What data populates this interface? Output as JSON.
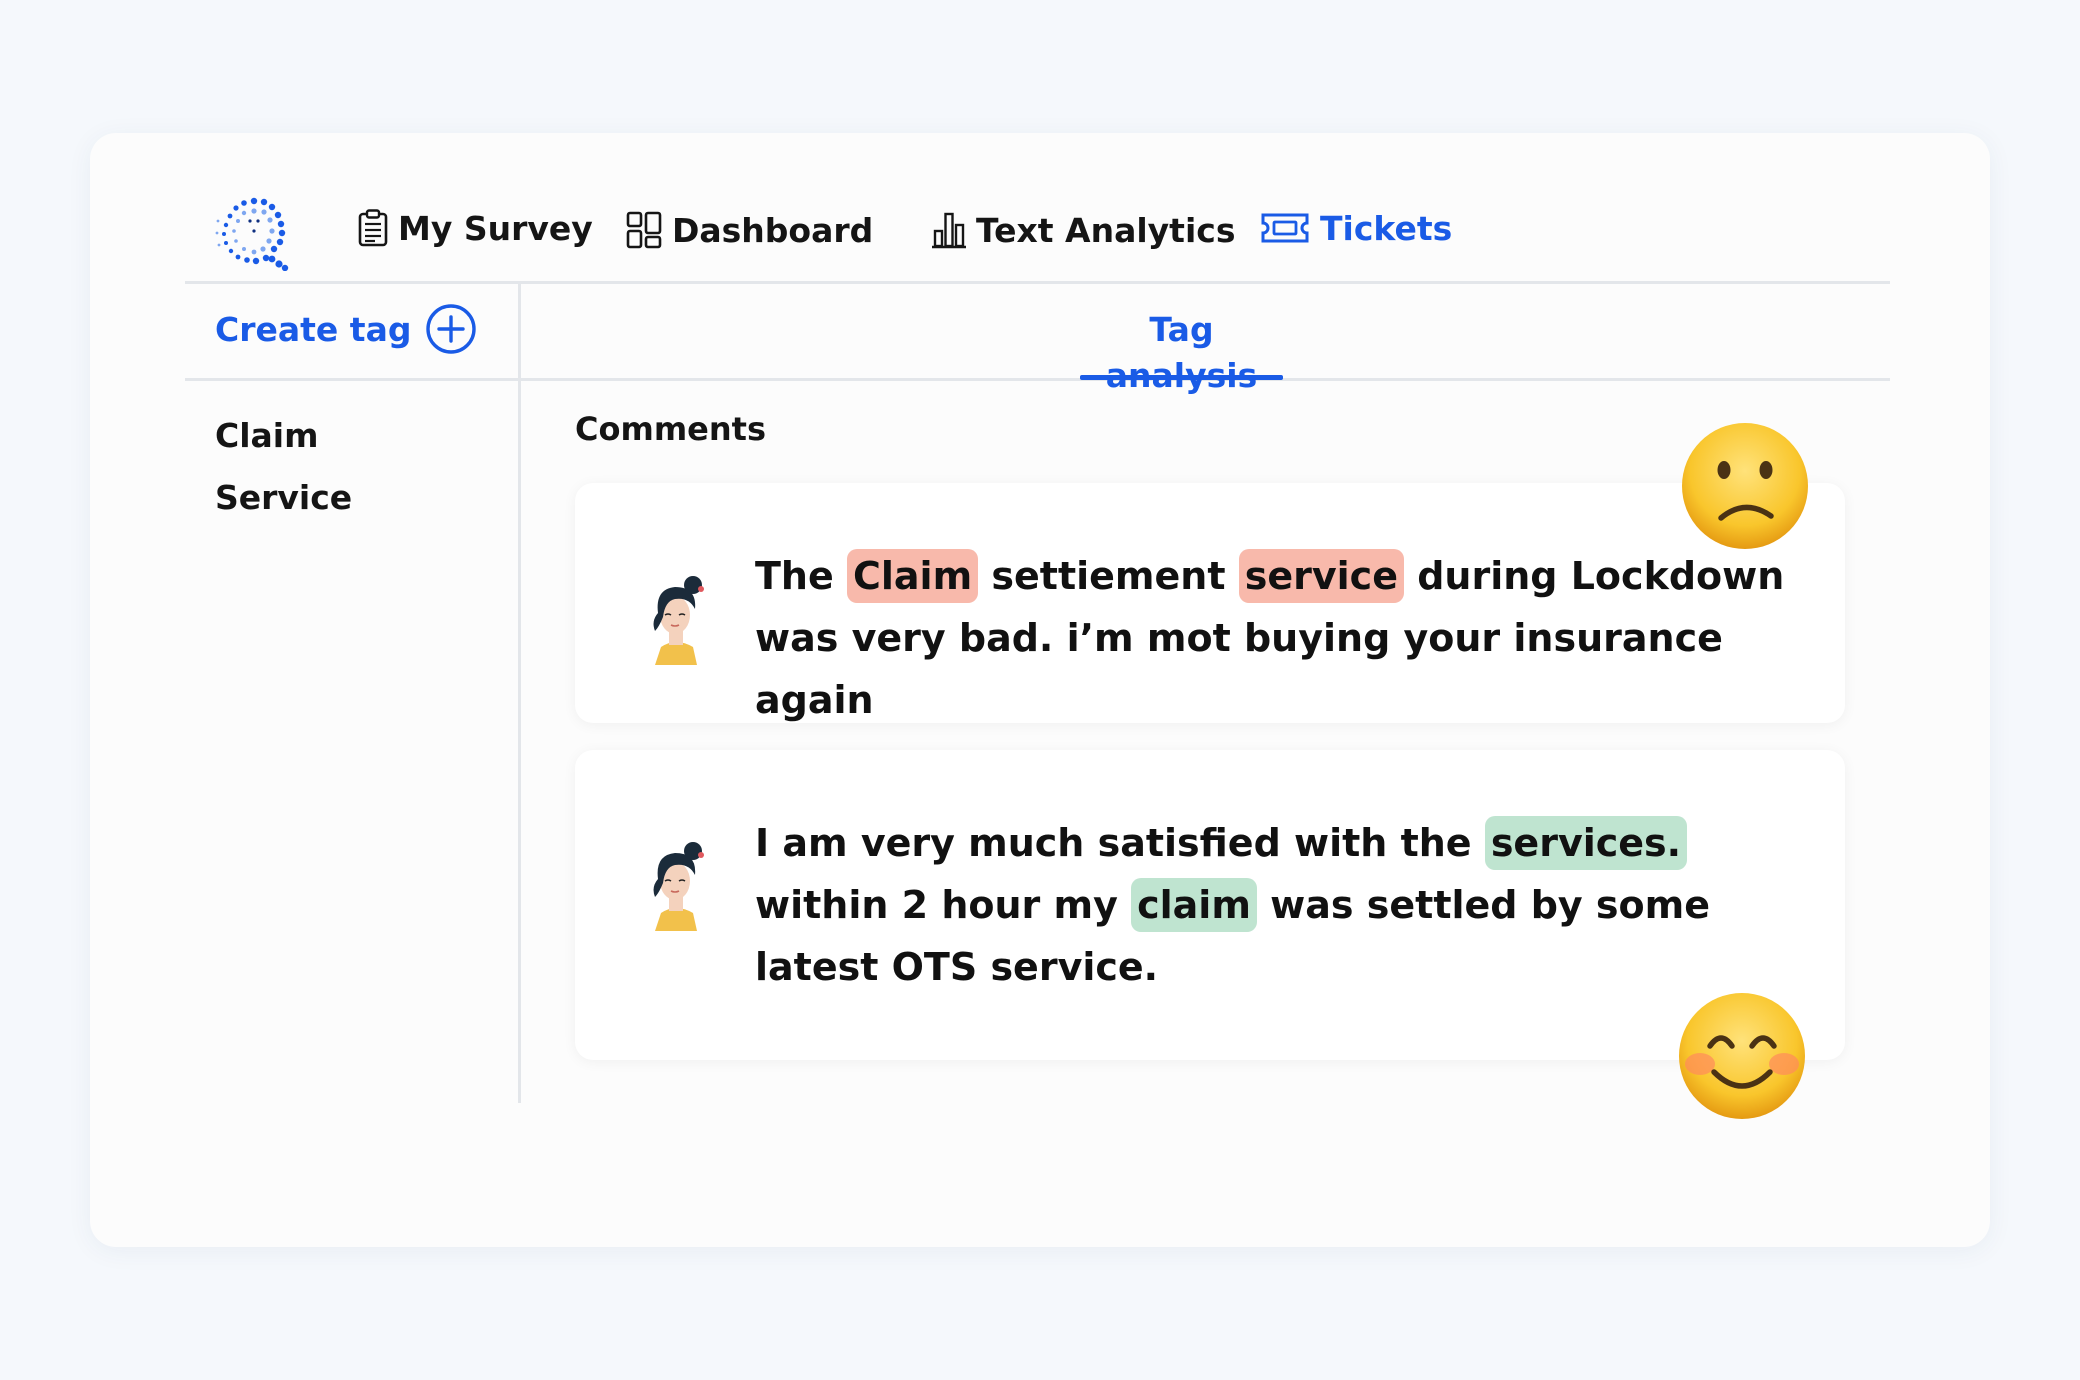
{
  "nav": {
    "items": [
      {
        "label": "My Survey",
        "icon": "clipboard-icon"
      },
      {
        "label": "Dashboard",
        "icon": "dashboard-grid-icon"
      },
      {
        "label": "Text Analytics",
        "icon": "bar-chart-icon"
      },
      {
        "label": "Tickets",
        "icon": "ticket-icon",
        "active": true
      }
    ]
  },
  "sidebar": {
    "create_label": "Create tag",
    "tags": [
      "Claim",
      "Service"
    ]
  },
  "main": {
    "tab_label": "Tag analysis",
    "heading": "Comments",
    "comments": [
      {
        "sentiment": "negative",
        "emoji": "sad-face-emoji",
        "segments": [
          "The ",
          "Claim",
          " settiement ",
          "service",
          " during Lockdown was very bad. i’m mot buying your insurance again"
        ]
      },
      {
        "sentiment": "positive",
        "emoji": "smiling-blush-emoji",
        "segments": [
          "I am very much satisfied with the ",
          "services.",
          " within 2 hour my ",
          "claim",
          " was settled by some latest OTS service."
        ]
      }
    ]
  },
  "colors": {
    "accent": "#1a5be6",
    "negative_highlight": "#f8b9ab",
    "positive_highlight": "#bfe4d0",
    "divider": "#e3e6ea"
  }
}
